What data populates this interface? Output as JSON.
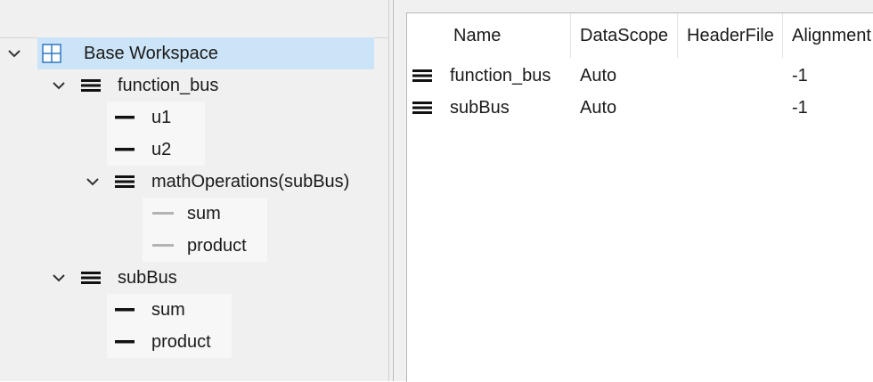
{
  "tree": {
    "root": {
      "label": "Base Workspace",
      "icon": "workspace-grid-icon"
    },
    "function_bus": {
      "label": "function_bus",
      "elements": [
        "u1",
        "u2"
      ],
      "nested": {
        "label": "mathOperations(subBus)",
        "elements": [
          "sum",
          "product"
        ]
      }
    },
    "subBus": {
      "label": "subBus",
      "elements": [
        "sum",
        "product"
      ]
    }
  },
  "table": {
    "columns": [
      "Name",
      "DataScope",
      "HeaderFile",
      "Alignment"
    ],
    "rows": [
      {
        "name": "function_bus",
        "datascope": "Auto",
        "headerfile": "",
        "alignment": "-1"
      },
      {
        "name": "subBus",
        "datascope": "Auto",
        "headerfile": "",
        "alignment": "-1"
      }
    ]
  },
  "colors": {
    "selection": "#cce4f7",
    "pane_bg": "#f0f0f0",
    "workspace_icon": "#2f78c4"
  }
}
